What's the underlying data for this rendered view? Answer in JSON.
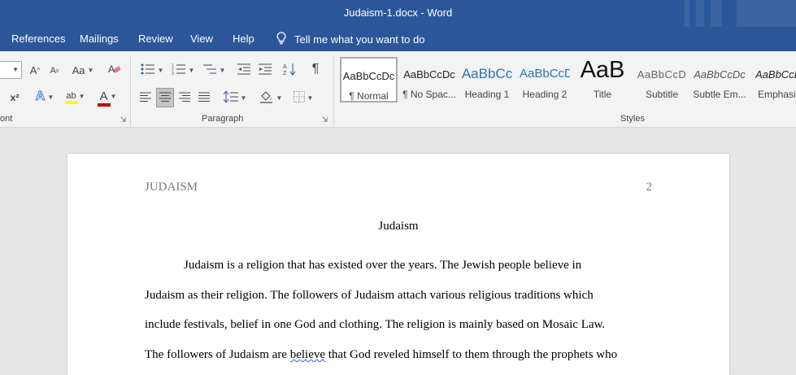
{
  "window": {
    "title": "Judaism-1.docx  -  Word"
  },
  "tabs": {
    "references": "References",
    "mailings": "Mailings",
    "review": "Review",
    "view": "View",
    "help": "Help",
    "tell_me": "Tell me what you want to do"
  },
  "ribbon": {
    "groups": {
      "font": "ont",
      "paragraph": "Paragraph",
      "styles": "Styles"
    },
    "font": {
      "grow": "A",
      "shrink": "A",
      "case": "Aa",
      "superscript": "x²",
      "effects": "A",
      "highlight": "ab",
      "color": "A"
    },
    "paragraph": {
      "pilcrow": "¶"
    },
    "colors": {
      "font_red": "#c00000",
      "highlight_yellow": "#ffff00",
      "effects_blue": "#3a7bd5"
    },
    "styles": [
      {
        "preview": "AaBbCcDc",
        "name": "¶ Normal"
      },
      {
        "preview": "AaBbCcDc",
        "name": "¶ No Spac..."
      },
      {
        "preview": "AaBbCc",
        "name": "Heading 1"
      },
      {
        "preview": "AaBbCcD",
        "name": "Heading 2"
      },
      {
        "preview": "AaB",
        "name": "Title"
      },
      {
        "preview": "AaBbCcD",
        "name": "Subtitle"
      },
      {
        "preview": "AaBbCcDc",
        "name": "Subtle Em..."
      },
      {
        "preview": "AaBbCcDc",
        "name": "Emphasi"
      }
    ]
  },
  "document": {
    "header_left": "JUDAISM",
    "header_page": "2",
    "title": "Judaism",
    "lines": [
      "Judaism is a religion that has existed over the years. The Jewish people believe in",
      "Judaism as their religion. The followers of Judaism attach various religious traditions which",
      "include festivals, belief in one God and clothing. The religion is mainly based on Mosaic Law."
    ],
    "line4": {
      "before": "The followers of Judaism are ",
      "error": "believe",
      "after": " that God reveled himself to them through the prophets who"
    }
  }
}
